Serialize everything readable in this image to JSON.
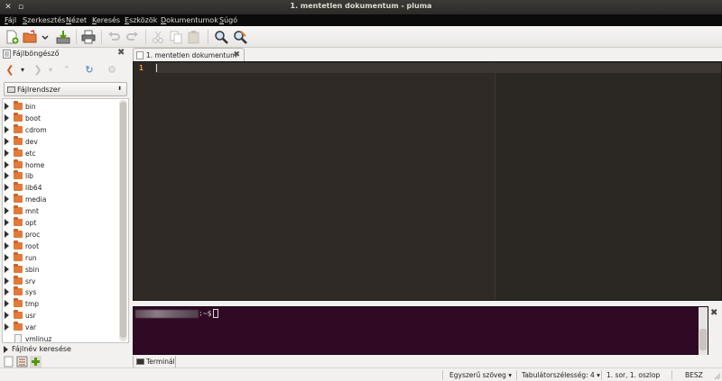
{
  "window": {
    "title": "1. mentetlen dokumentum - pluma"
  },
  "menubar": {
    "items": [
      "Fájl",
      "Szerkesztés",
      "Nézet",
      "Keresés",
      "Eszközök",
      "Dokumentumok",
      "Súgó"
    ]
  },
  "toolbar": {
    "buttons": [
      "new-document-icon",
      "open-folder-icon",
      "open-dropdown-icon",
      "save-icon",
      "print-icon",
      "undo-icon",
      "redo-icon",
      "cut-icon",
      "copy-icon",
      "paste-icon",
      "find-icon",
      "find-replace-icon"
    ]
  },
  "side_panel": {
    "title": "Fájlböngésző",
    "location": "Fájlrendszer",
    "tree": [
      {
        "name": "bin",
        "type": "folder"
      },
      {
        "name": "boot",
        "type": "folder"
      },
      {
        "name": "cdrom",
        "type": "folder"
      },
      {
        "name": "dev",
        "type": "folder"
      },
      {
        "name": "etc",
        "type": "folder"
      },
      {
        "name": "home",
        "type": "folder"
      },
      {
        "name": "lib",
        "type": "folder"
      },
      {
        "name": "lib64",
        "type": "folder"
      },
      {
        "name": "media",
        "type": "folder"
      },
      {
        "name": "mnt",
        "type": "folder"
      },
      {
        "name": "opt",
        "type": "folder"
      },
      {
        "name": "proc",
        "type": "folder"
      },
      {
        "name": "root",
        "type": "folder"
      },
      {
        "name": "run",
        "type": "folder"
      },
      {
        "name": "sbin",
        "type": "folder"
      },
      {
        "name": "srv",
        "type": "folder"
      },
      {
        "name": "sys",
        "type": "folder"
      },
      {
        "name": "tmp",
        "type": "folder"
      },
      {
        "name": "usr",
        "type": "folder"
      },
      {
        "name": "var",
        "type": "folder"
      },
      {
        "name": "vmlinuz",
        "type": "file"
      }
    ],
    "search_expander": "Fájlnév keresése"
  },
  "editor": {
    "tab_label": "1. mentetlen dokumentum",
    "line_number": "1"
  },
  "terminal": {
    "prompt_suffix": ":~$",
    "tab_label": "Terminál"
  },
  "statusbar": {
    "syntax": "Egyszerű szöveg",
    "tab_width": "Tabulátorszélesség:  4",
    "position": "1. sor, 1. oszlop",
    "mode": "BESZ"
  }
}
